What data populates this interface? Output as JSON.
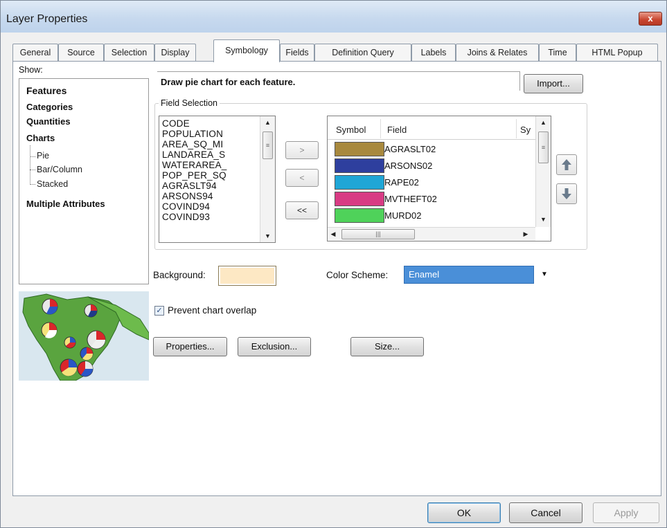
{
  "window": {
    "title": "Layer Properties",
    "close_label": "x"
  },
  "tabs": [
    {
      "label": "General"
    },
    {
      "label": "Source"
    },
    {
      "label": "Selection"
    },
    {
      "label": "Display"
    },
    {
      "label": "Symbology",
      "active": true
    },
    {
      "label": "Fields"
    },
    {
      "label": "Definition Query"
    },
    {
      "label": "Labels"
    },
    {
      "label": "Joins & Relates"
    },
    {
      "label": "Time"
    },
    {
      "label": "HTML Popup"
    }
  ],
  "show": {
    "label": "Show:",
    "items": [
      {
        "label": "Features"
      },
      {
        "label": "Categories"
      },
      {
        "label": "Quantities"
      },
      {
        "label": "Charts"
      },
      {
        "label": "Pie"
      },
      {
        "label": "Bar/Column"
      },
      {
        "label": "Stacked"
      },
      {
        "label": "Multiple Attributes"
      }
    ]
  },
  "description": "Draw pie chart for each feature.",
  "import_button": "Import...",
  "field_selection": {
    "label": "Field Selection",
    "fields": [
      "CODE",
      "POPULATION",
      "AREA_SQ_MI",
      "LANDAREA_S",
      "WATERAREA_",
      "POP_PER_SQ",
      "AGRASLT94",
      "ARSONS94",
      "COVIND94",
      "COVIND93"
    ],
    "add_button": ">",
    "remove_button": "<",
    "remove_all_button": "<<"
  },
  "symbol_table": {
    "col_symbol": "Symbol",
    "col_field": "Field",
    "col_extra": "Sy",
    "rows": [
      {
        "field": "AGRASLT02",
        "color": "#a8893e"
      },
      {
        "field": "ARSONS02",
        "color": "#2e3f9e"
      },
      {
        "field": "RAPE02",
        "color": "#1fa6d6"
      },
      {
        "field": "MVTHEFT02",
        "color": "#d83b84"
      },
      {
        "field": "MURD02",
        "color": "#4fd25a"
      }
    ],
    "hscroll_grip": "|||",
    "vscroll_grip": "≡"
  },
  "background": {
    "label": "Background:",
    "color": "#fde8c4"
  },
  "color_scheme": {
    "label": "Color Scheme:",
    "value": "Enamel"
  },
  "prevent_overlap": {
    "label": "Prevent chart overlap",
    "checked": true,
    "mark": "✓"
  },
  "buttons": {
    "properties": "Properties...",
    "exclusion": "Exclusion...",
    "size": "Size..."
  },
  "footer": {
    "ok": "OK",
    "cancel": "Cancel",
    "apply": "Apply"
  },
  "icons": {
    "up": "up-arrow-icon",
    "down": "down-arrow-icon",
    "dropdown": "chevron-down-icon"
  }
}
